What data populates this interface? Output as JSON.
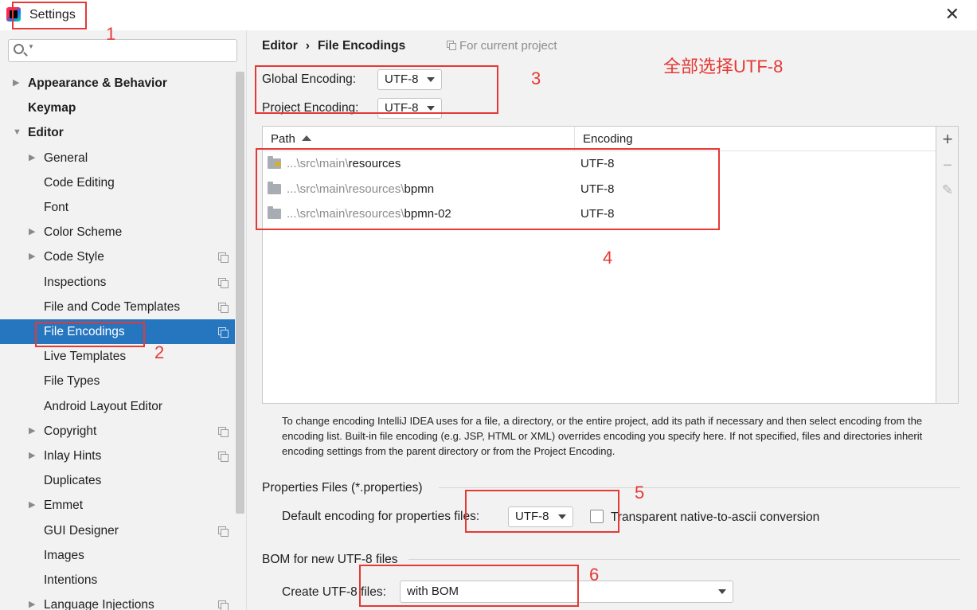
{
  "window": {
    "title": "Settings",
    "close_label": "✕"
  },
  "annotations": {
    "n1": "1",
    "n2": "2",
    "n3": "3",
    "n4": "4",
    "n5": "5",
    "n6": "6",
    "note": "全部选择UTF-8",
    "color": "#e53935"
  },
  "sidebar": {
    "search": {
      "value": "",
      "placeholder": ""
    },
    "items": [
      {
        "label": "Appearance & Behavior",
        "bold": true,
        "arrow": "collapsed"
      },
      {
        "label": "Keymap",
        "bold": true
      },
      {
        "label": "Editor",
        "bold": true,
        "arrow": "expanded"
      },
      {
        "label": "General",
        "arrow": "collapsed"
      },
      {
        "label": "Code Editing"
      },
      {
        "label": "Font"
      },
      {
        "label": "Color Scheme",
        "arrow": "collapsed"
      },
      {
        "label": "Code Style",
        "arrow": "collapsed",
        "project_icon": true
      },
      {
        "label": "Inspections",
        "project_icon": true
      },
      {
        "label": "File and Code Templates",
        "project_icon": true
      },
      {
        "label": "File Encodings",
        "selected": true,
        "project_icon": true
      },
      {
        "label": "Live Templates"
      },
      {
        "label": "File Types"
      },
      {
        "label": "Android Layout Editor"
      },
      {
        "label": "Copyright",
        "arrow": "collapsed",
        "project_icon": true
      },
      {
        "label": "Inlay Hints",
        "arrow": "collapsed",
        "project_icon": true
      },
      {
        "label": "Duplicates"
      },
      {
        "label": "Emmet",
        "arrow": "collapsed"
      },
      {
        "label": "GUI Designer",
        "project_icon": true
      },
      {
        "label": "Images"
      },
      {
        "label": "Intentions"
      },
      {
        "label": "Language Injections",
        "arrow": "collapsed",
        "project_icon": true
      }
    ],
    "selected_color": "#2675bf"
  },
  "main": {
    "breadcrumb": {
      "parent": "Editor",
      "separator": "›",
      "current": "File Encodings"
    },
    "scope_note": "For current project",
    "global_encoding": {
      "label": "Global Encoding:",
      "value": "UTF-8"
    },
    "project_encoding": {
      "label": "Project Encoding:",
      "value": "UTF-8"
    },
    "table": {
      "columns": [
        "Path",
        "Encoding"
      ],
      "rows": [
        {
          "prefix": "...\\src\\main\\",
          "name": "resources",
          "encoding": "UTF-8",
          "icon": "resources-folder-icon"
        },
        {
          "prefix": "...\\src\\main\\resources\\",
          "name": "bpmn",
          "encoding": "UTF-8",
          "icon": "folder-icon"
        },
        {
          "prefix": "...\\src\\main\\resources\\",
          "name": "bpmn-02",
          "encoding": "UTF-8",
          "icon": "folder-icon"
        }
      ],
      "toolbar": {
        "add": "+",
        "remove": "−",
        "edit": "✎"
      }
    },
    "info": "To change encoding IntelliJ IDEA uses for a file, a directory, or the entire project, add its path if necessary and then select encoding from the encoding list. Built-in file encoding (e.g. JSP, HTML or XML) overrides encoding you specify here. If not specified, files and directories inherit encoding settings from the parent directory or from the Project Encoding.",
    "properties": {
      "title": "Properties Files (*.properties)",
      "default_label": "Default encoding for properties files:",
      "default_value": "UTF-8",
      "transparent_label": "Transparent native-to-ascii conversion",
      "transparent_checked": false
    },
    "bom": {
      "title": "BOM for new UTF-8 files",
      "create_label": "Create UTF-8 files:",
      "create_value": "with BOM"
    }
  }
}
